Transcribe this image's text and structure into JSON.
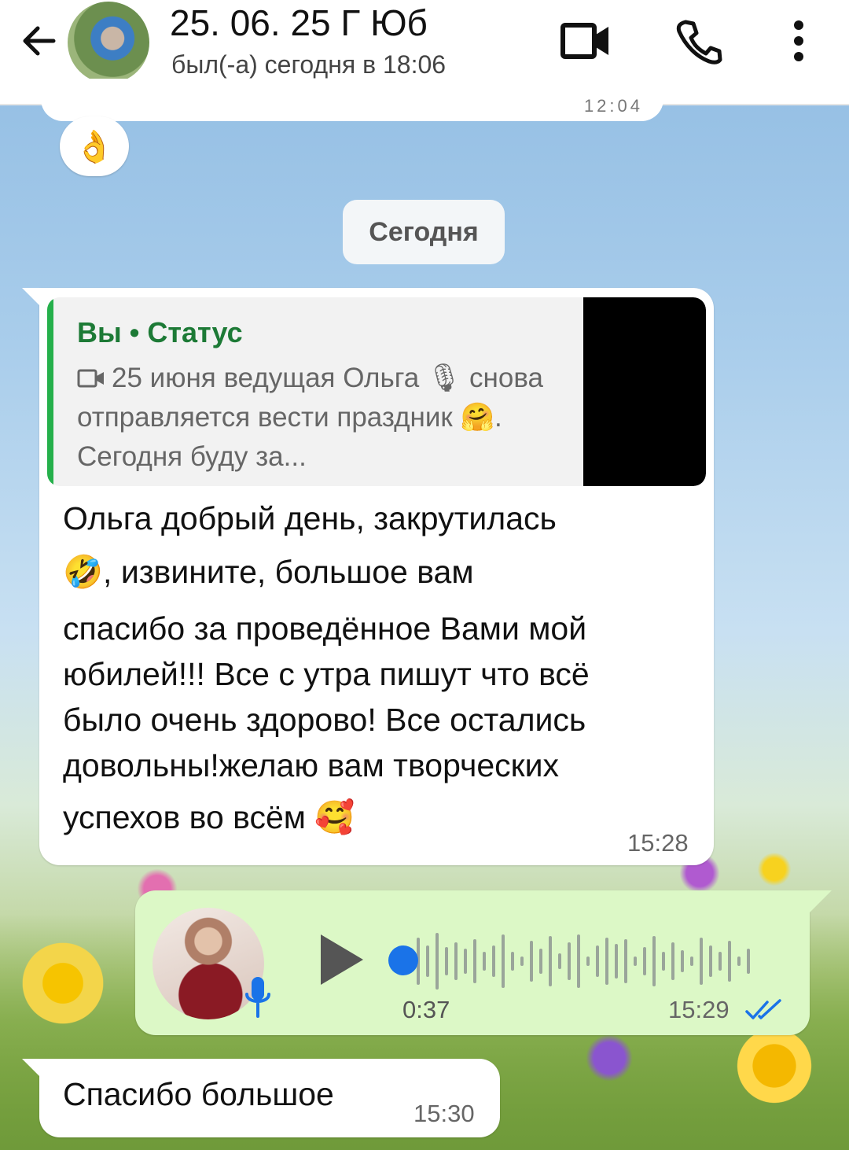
{
  "header": {
    "title": "25. 06. 25 Г Юб",
    "status": "был(-а) сегодня в 18:06"
  },
  "previous": {
    "time": "12:04",
    "reaction": "👌"
  },
  "date_chip": "Сегодня",
  "msg1": {
    "quote_author": "Вы • Статус",
    "quote_text": "25 июня ведущая Ольга 🎙 снова отправляется вести праздник 🤗. Сегодня буду за...",
    "lines": [
      "Ольга добрый день, закрутилась",
      "🤣, извините, большое вам",
      "спасибо за проведённое Вами мой",
      "юбилей!!! Все с утра пишут что всё",
      "было очень здорово! Все остались",
      "довольны!желаю вам творческих",
      "успехов во всём 🥰"
    ],
    "time": "15:28"
  },
  "voice": {
    "duration": "0:37",
    "time": "15:29",
    "progress": 0
  },
  "msg2": {
    "text": "Спасибо большое",
    "time": "15:30"
  },
  "colors": {
    "accent": "#1a73e8",
    "outgoing": "#dcf8c6",
    "quote_bar": "#25b04b"
  }
}
